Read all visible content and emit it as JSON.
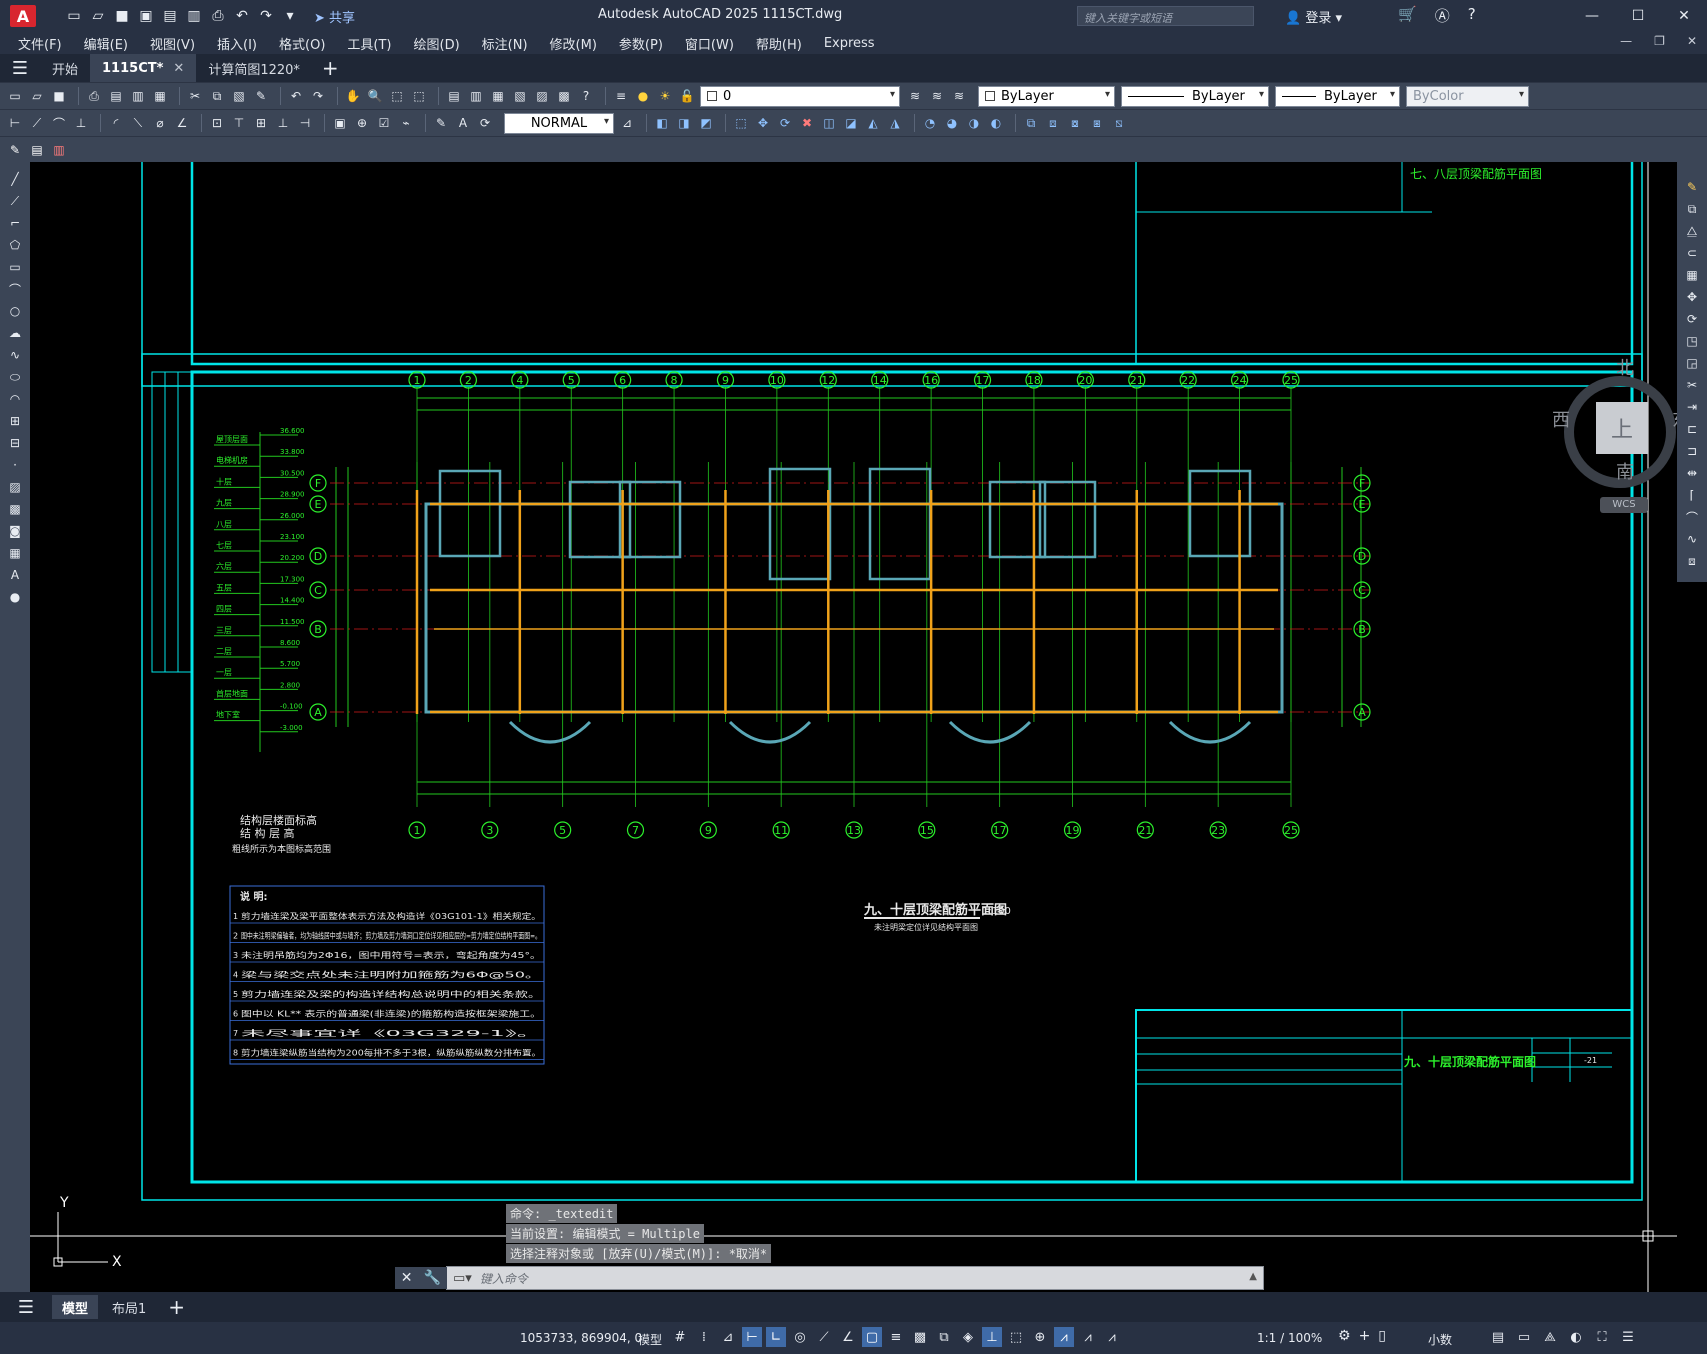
{
  "app": {
    "logo": "A",
    "title": "Autodesk AutoCAD 2025    1115CT.dwg",
    "share_label": "共享",
    "search_placeholder": "键入关键字或短语",
    "login_label": "登录"
  },
  "menu": [
    "文件(F)",
    "编辑(E)",
    "视图(V)",
    "插入(I)",
    "格式(O)",
    "工具(T)",
    "绘图(D)",
    "标注(N)",
    "修改(M)",
    "参数(P)",
    "窗口(W)",
    "帮助(H)",
    "Express"
  ],
  "tabs": [
    {
      "label": "开始",
      "active": false
    },
    {
      "label": "1115CT*",
      "active": true
    },
    {
      "label": "计算简图1220*",
      "active": false
    }
  ],
  "properties": {
    "textstyle": "NORMAL",
    "layer": "0",
    "color": "ByLayer",
    "linetype": "ByLayer",
    "lineweight": "ByLayer",
    "plotstyle": "ByColor"
  },
  "viewcube": {
    "north": "北",
    "south": "南",
    "west": "西",
    "east": "东",
    "top": "上",
    "wcs": "WCS"
  },
  "drawing": {
    "title_top": "七、八层顶梁配筋平面图",
    "title_main": "九、十层顶梁配筋平面图",
    "scale": "1:100",
    "subtitle": "未注明梁定位详见结构平面图",
    "elev_caption1": "结构层楼面标高",
    "elev_caption2": "结 构 层 高",
    "elev_caption3": "粗线所示为本图标高范围",
    "sheet_no": "-21",
    "notes_title": "说 明:",
    "notes": [
      "剪力墙连梁及梁平面整体表示方法及构造详《03G101-1》相关规定。",
      "图中未注明梁偏轴者，均为轴线居中或与墙齐；剪力墙及剪力墙洞口定位详见相应层的=剪力墙定位结构平面图=。",
      "未注明吊筋均为2Φ16，图中用符号=表示，弯起角度为45°。",
      "梁与梁交点处未注明附加箍筋为6Φ@50。",
      "剪力墙连梁及梁的构造详结构总说明中的相关条款。",
      "图中以 KL** 表示的普通梁(非连梁)的箍筋构造按框架梁施工。",
      "未尽事宜详《03G329-1》。",
      "剪力墙连梁纵筋当结构为200每排不多于3根，纵筋纵筋纵数分排布置。"
    ],
    "top_axes": [
      "1",
      "2",
      "4",
      "5",
      "6",
      "8",
      "9",
      "10",
      "12",
      "14",
      "16",
      "17",
      "18",
      "20",
      "21",
      "22",
      "24",
      "25"
    ],
    "bottom_axes": [
      "1",
      "3",
      "5",
      "7",
      "9",
      "11",
      "13",
      "15",
      "17",
      "19",
      "21",
      "23",
      "25"
    ],
    "side_axes": [
      "F",
      "E",
      "D",
      "C",
      "B",
      "A"
    ],
    "floors": [
      "屋顶层面",
      "电梯机房",
      "十层",
      "九层",
      "八层",
      "七层",
      "六层",
      "五层",
      "四层",
      "三层",
      "二层",
      "一层",
      "首层地面",
      "地下室"
    ],
    "elevations": [
      "36.600",
      "33.800",
      "30.500",
      "28.900",
      "26.000",
      "23.100",
      "20.200",
      "17.300",
      "14.400",
      "11.500",
      "8.600",
      "5.700",
      "2.800",
      "-0.100",
      "-3.000"
    ]
  },
  "command": {
    "history": [
      "命令: _textedit",
      "当前设置: 编辑模式 = Multiple",
      "选择注释对象或 [放弃(U)/模式(M)]: *取消*"
    ],
    "placeholder": "键入命令"
  },
  "layout_tabs": [
    {
      "label": "模型",
      "active": true
    },
    {
      "label": "布局1",
      "active": false
    }
  ],
  "status": {
    "coords": "1053733, 869904, 0",
    "model": "模型",
    "scale": "1:1 / 100%",
    "units": "小数"
  },
  "colors": {
    "frame": "#00e5e8",
    "grid": "#22c81e",
    "axis_red": "#d51a1a",
    "beam": "#f0a21a",
    "wall": "#5aa7b6",
    "text_green": "#2cf02c"
  }
}
